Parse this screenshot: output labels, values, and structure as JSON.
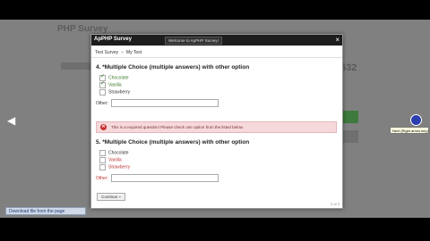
{
  "background": {
    "page_title": "PHP Survey",
    "stat_number": "632"
  },
  "browser": {
    "download_label": "Download file from the page",
    "tooltip": "Next (Right arrow key)",
    "nav_prev_icon": "triangle-left-icon"
  },
  "modal": {
    "title": "ApPHP Survey",
    "subtitle": "Welcome to ApPHP Survey!",
    "close_glyph": "×",
    "page_indicator": "3 of 3"
  },
  "breadcrumb": {
    "items": [
      "Test Survey",
      "My Test"
    ],
    "separator": "»"
  },
  "question4": {
    "title": "4. *Multiple Choice (multiple answers) with other option",
    "options": [
      {
        "label": "Chocolate",
        "checked": true
      },
      {
        "label": "Vanilla",
        "checked": true
      },
      {
        "label": "Strawberry",
        "checked": false
      }
    ],
    "other_label": "Other:"
  },
  "error": {
    "icon": "x-icon",
    "message": "This is a required question! Please check one option from the listed below."
  },
  "question5": {
    "title": "5. *Multiple Choice (multiple answers) with other option",
    "options": [
      {
        "label": "Chocolate",
        "checked": false
      },
      {
        "label": "Vanilla",
        "checked": false
      },
      {
        "label": "Strawberry",
        "checked": false
      }
    ],
    "other_label": "Other:"
  },
  "continue_button": "Continue »",
  "colors": {
    "error_bg": "#f6d9da",
    "error_icon": "#c83232",
    "checked_label": "#3d7a2a",
    "required_label": "#bb3333"
  }
}
